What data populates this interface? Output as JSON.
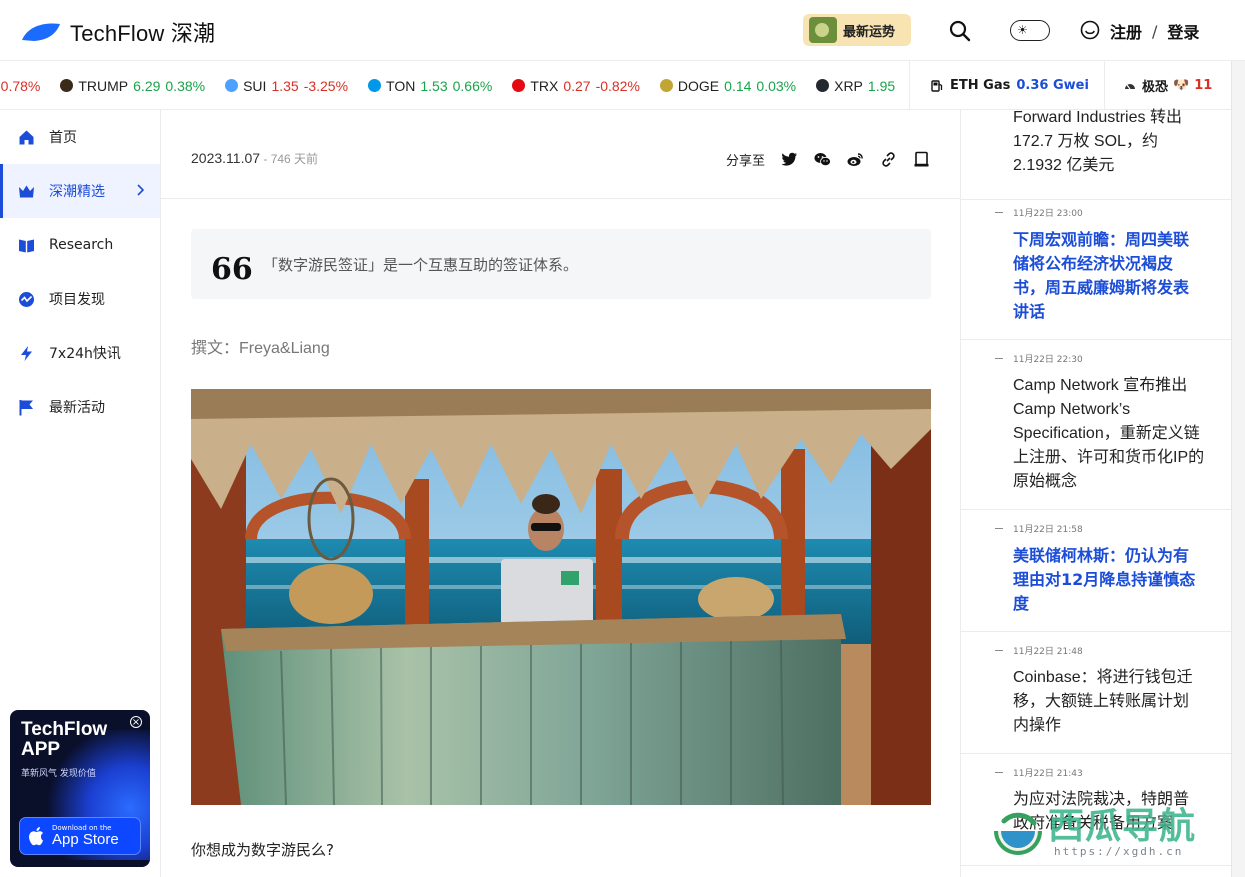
{
  "header": {
    "brand": "TechFlow 深潮",
    "promo_label": "最新运势",
    "register_label": "注册",
    "separator": "/",
    "login_label": "登录"
  },
  "ticker": {
    "items": [
      {
        "symbol": "",
        "price": "",
        "change": "-0.78%",
        "direction": "down",
        "icon_color": "#d93025"
      },
      {
        "symbol": "TRUMP",
        "price": "6.29",
        "change": "0.38%",
        "direction": "up",
        "icon_color": "#3b2a1a"
      },
      {
        "symbol": "SUI",
        "price": "1.35",
        "change": "-3.25%",
        "direction": "down",
        "icon_color": "#4da2ff"
      },
      {
        "symbol": "TON",
        "price": "1.53",
        "change": "0.66%",
        "direction": "up",
        "icon_color": "#0098ea"
      },
      {
        "symbol": "TRX",
        "price": "0.27",
        "change": "-0.82%",
        "direction": "down",
        "icon_color": "#e50914"
      },
      {
        "symbol": "DOGE",
        "price": "0.14",
        "change": "0.03%",
        "direction": "up",
        "icon_color": "#c2a633"
      },
      {
        "symbol": "XRP",
        "price": "1.95",
        "change": "",
        "direction": "up",
        "icon_color": "#23292f"
      }
    ],
    "gas_label": "ETH Gas",
    "gas_value": "0.36 Gwei",
    "fear_label": "极恐",
    "fear_value": "11"
  },
  "sidebar": {
    "items": [
      {
        "label": "首页",
        "icon": "home-icon"
      },
      {
        "label": "深潮精选",
        "icon": "crown-icon",
        "active": true
      },
      {
        "label": "Research",
        "icon": "book-icon"
      },
      {
        "label": "项目发现",
        "icon": "discover-icon"
      },
      {
        "label": "7x24h快讯",
        "icon": "lightning-icon"
      },
      {
        "label": "最新活动",
        "icon": "flag-icon"
      }
    ],
    "app_card": {
      "title_line1": "TechFlow",
      "title_line2": "APP",
      "slogan": "革新风气 发现价值",
      "store_small": "Download on the",
      "store_big": "App Store"
    }
  },
  "article": {
    "date": "2023.11.07",
    "ago": " - 746 天前",
    "share_label": "分享至",
    "quote_mark": "66",
    "quote": "「数字游民签证」是一个互惠互助的签证体系。",
    "author": "撰文：Freya&Liang",
    "body_first": "你想成为数字游民么?"
  },
  "feed": {
    "items": [
      {
        "time": "",
        "title": "Forward Industries 转出 172.7 万枚 SOL，约 2.1932 亿美元",
        "highlight": false
      },
      {
        "time": "11月22日 23:00",
        "title": "下周宏观前瞻：周四美联储将公布经济状况褐皮书，周五威廉姆斯将发表讲话",
        "highlight": true
      },
      {
        "time": "11月22日 22:30",
        "title": "Camp Network 宣布推出 Camp Network’s Specification，重新定义链上注册、许可和货币化IP的原始概念",
        "highlight": false
      },
      {
        "time": "11月22日 21:58",
        "title": "美联储柯林斯：仍认为有理由对12月降息持谨慎态度",
        "highlight": true
      },
      {
        "time": "11月22日 21:48",
        "title": "Coinbase：将进行钱包迁移，大额链上转账属计划内操作",
        "highlight": false
      },
      {
        "time": "11月22日 21:43",
        "title": "为应对法院裁决，特朗普政府准备关税备用方案",
        "highlight": false
      }
    ]
  },
  "watermark": {
    "text": "西瓜导航",
    "url": "https://xgdh.cn"
  },
  "colors": {
    "accent": "#1b4dd8",
    "up": "#1aa34a",
    "down": "#d93025"
  }
}
